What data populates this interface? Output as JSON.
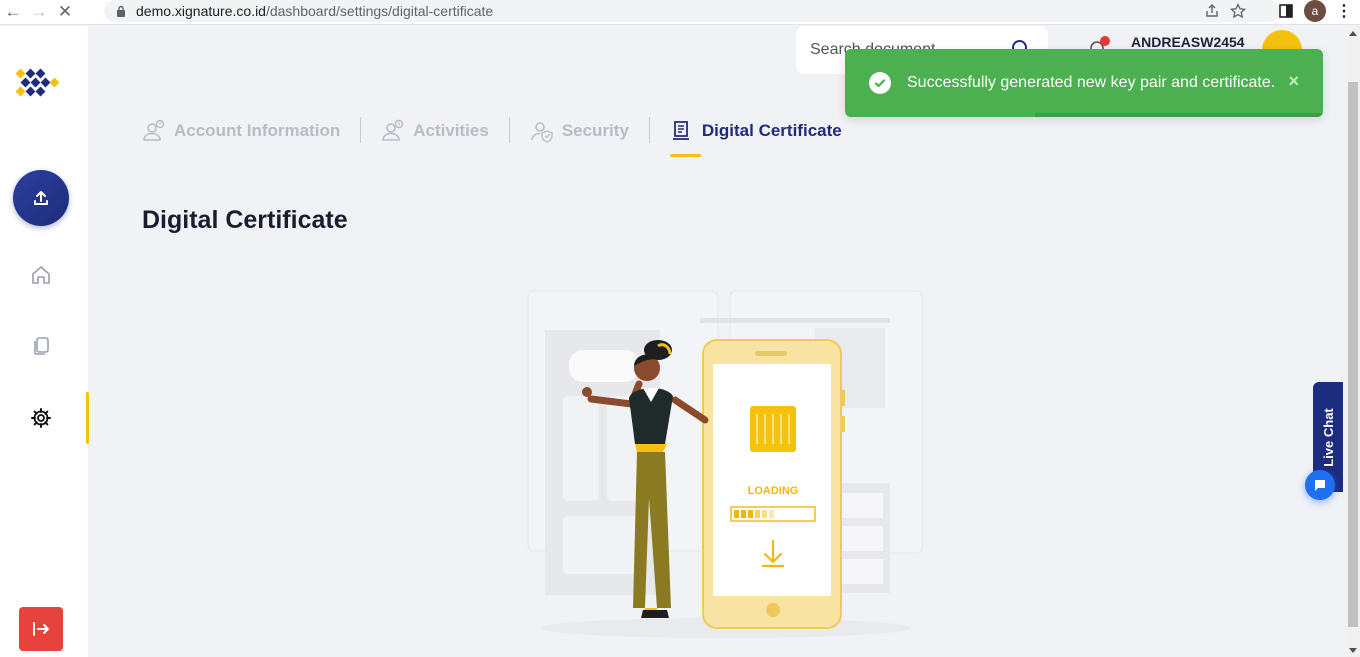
{
  "browser": {
    "url_host": "demo.xignature.co.id",
    "url_path": "/dashboard/settings/digital-certificate",
    "profile_letter": "a"
  },
  "header": {
    "search_placeholder": "Search document",
    "username": "ANDREASW2454"
  },
  "tabs": [
    {
      "label": "Account Information",
      "active": false
    },
    {
      "label": "Activities",
      "active": false
    },
    {
      "label": "Security",
      "active": false
    },
    {
      "label": "Digital Certificate",
      "active": true
    }
  ],
  "page": {
    "title": "Digital Certificate"
  },
  "illustration": {
    "loading_text": "LOADING"
  },
  "toast": {
    "message": "Successfully generated new key pair and certificate.",
    "close_symbol": "×"
  },
  "livechat": {
    "label": "Live Chat"
  },
  "colors": {
    "brand_navy": "#1f2c7c",
    "accent_yellow": "#f4c10f",
    "toast_green": "#4caf50",
    "logout_red": "#e8423d"
  }
}
